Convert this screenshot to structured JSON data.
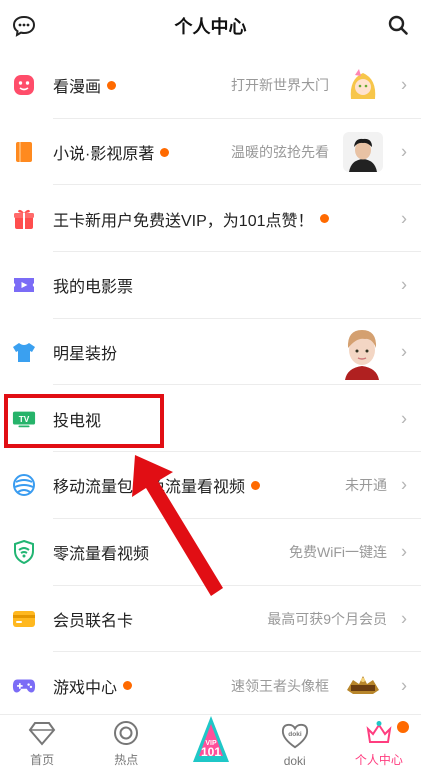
{
  "header": {
    "title": "个人中心",
    "left_icon": "message-icon",
    "right_icon": "search-icon"
  },
  "menu": [
    {
      "label": "看漫画",
      "dot": true,
      "sub": "打开新世界大门",
      "icon": "comic-icon",
      "icon_color": "#ff4d6a",
      "thumb": "anime-girl"
    },
    {
      "label": "小说·影视原著",
      "dot": true,
      "sub": "温暖的弦抢先看",
      "icon": "book-icon",
      "icon_color": "#ff8a1f",
      "thumb": "man-portrait"
    },
    {
      "label": "王卡新用户免费送VIP，为101点赞！",
      "dot": true,
      "sub": "",
      "icon": "gift-icon",
      "icon_color": "#ff4d4d"
    },
    {
      "label": "我的电影票",
      "dot": false,
      "sub": "",
      "icon": "ticket-icon",
      "icon_color": "#7b6cf6"
    },
    {
      "label": "明星装扮",
      "dot": false,
      "sub": "",
      "icon": "tshirt-icon",
      "icon_color": "#3aa0f0",
      "thumb": "star-portrait"
    },
    {
      "label": "投电视",
      "dot": false,
      "sub": "",
      "icon": "tv-icon",
      "icon_color": "#26b36a",
      "tv_text": "TV"
    },
    {
      "label": "移动流量包，免流量看视频",
      "dot": true,
      "sub": "未开通",
      "icon": "mobile-data-icon",
      "icon_color": "#3a9cf0"
    },
    {
      "label": "零流量看视频",
      "dot": false,
      "sub": "免费WiFi一键连",
      "icon": "shield-wifi-icon",
      "icon_color": "#22b573"
    },
    {
      "label": "会员联名卡",
      "dot": false,
      "sub": "最高可获9个月会员",
      "icon": "card-icon",
      "icon_color": "#ffb81f"
    },
    {
      "label": "游戏中心",
      "dot": true,
      "sub": "速领王者头像框",
      "icon": "gamepad-icon",
      "icon_color": "#7b6cf6",
      "thumb": "game-logo"
    }
  ],
  "tabs": [
    {
      "label": "首页",
      "icon": "home-diamond-icon",
      "active": false
    },
    {
      "label": "热点",
      "icon": "hot-circle-icon",
      "active": false
    },
    {
      "label": "",
      "icon": "vip-101-icon",
      "active": false,
      "badge_text": "101",
      "vip_text": "VIP"
    },
    {
      "label": "doki",
      "icon": "doki-heart-icon",
      "active": false,
      "heart_text": "doki"
    },
    {
      "label": "个人中心",
      "icon": "crown-icon",
      "active": true,
      "badge": true
    }
  ],
  "colors": {
    "accent": "#ff3d7f",
    "dot": "#ff6a00",
    "annotation": "#e10e14"
  }
}
